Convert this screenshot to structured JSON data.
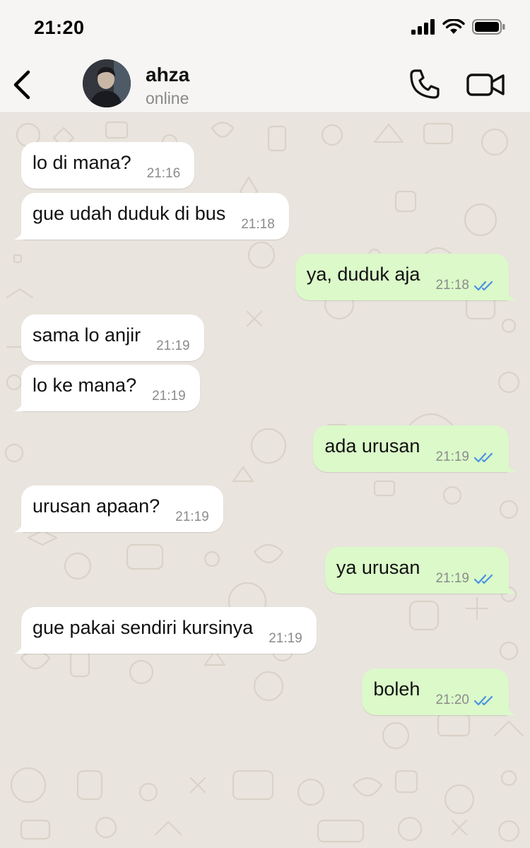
{
  "status_bar": {
    "time": "21:20"
  },
  "header": {
    "contact_name": "ahza",
    "contact_status": "online"
  },
  "colors": {
    "incoming_bubble": "#ffffff",
    "outgoing_bubble": "#dbf9c9",
    "chat_background": "#e9e4dd",
    "read_ticks": "#4a90e2"
  },
  "messages": [
    {
      "direction": "in",
      "text": "lo di mana?",
      "time": "21:16"
    },
    {
      "direction": "in",
      "text": "gue udah duduk di bus",
      "time": "21:18"
    },
    {
      "direction": "out",
      "text": "ya, duduk aja",
      "time": "21:18",
      "status": "read"
    },
    {
      "direction": "in",
      "text": "sama lo anjir",
      "time": "21:19"
    },
    {
      "direction": "in",
      "text": "lo ke mana?",
      "time": "21:19"
    },
    {
      "direction": "out",
      "text": "ada urusan",
      "time": "21:19",
      "status": "read"
    },
    {
      "direction": "in",
      "text": "urusan apaan?",
      "time": "21:19"
    },
    {
      "direction": "out",
      "text": "ya urusan",
      "time": "21:19",
      "status": "read"
    },
    {
      "direction": "in",
      "text": "gue pakai sendiri kursinya",
      "time": "21:19"
    },
    {
      "direction": "out",
      "text": "boleh",
      "time": "21:20",
      "status": "read"
    }
  ]
}
